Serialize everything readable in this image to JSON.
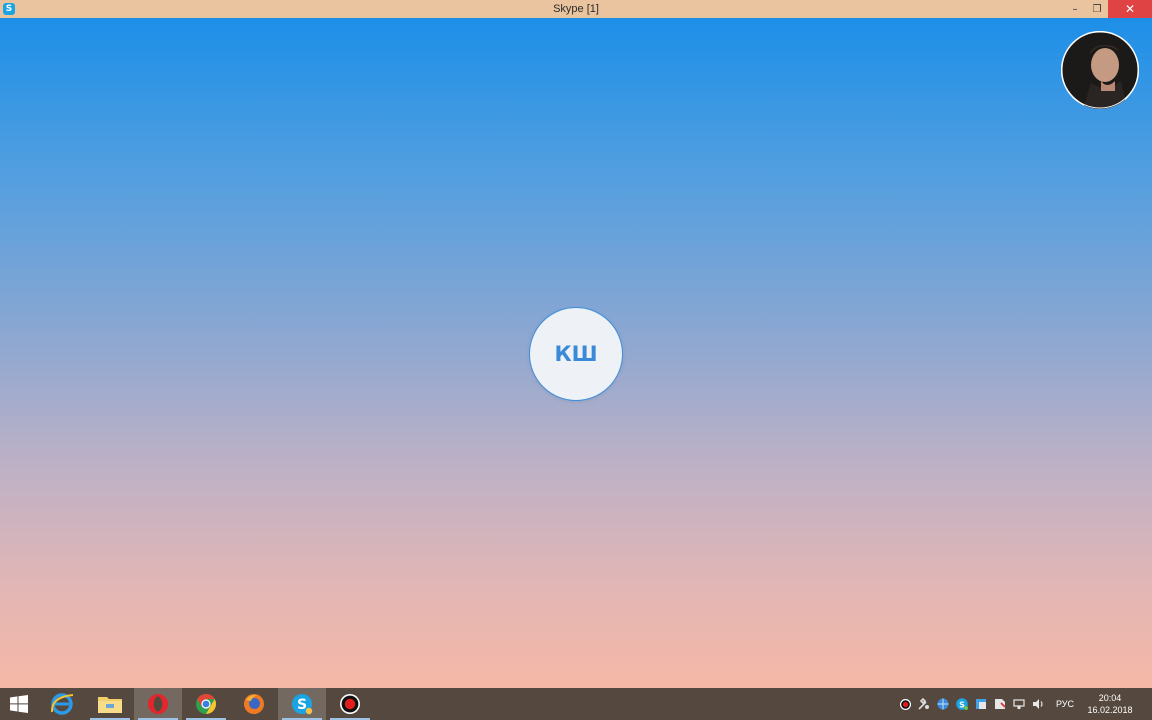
{
  "window": {
    "title": "Skype [1]",
    "app_icon_letter": "S",
    "minimize": "–",
    "restore": "❐",
    "close": "✕"
  },
  "call": {
    "remote_initials": "КШ"
  },
  "taskbar": {
    "apps": [
      {
        "icon": "windows-start-icon"
      },
      {
        "icon": "internet-explorer-icon"
      },
      {
        "icon": "file-explorer-icon"
      },
      {
        "icon": "opera-icon"
      },
      {
        "icon": "chrome-icon"
      },
      {
        "icon": "firefox-icon"
      },
      {
        "icon": "skype-icon"
      },
      {
        "icon": "record-icon"
      }
    ],
    "tray": {
      "language": "РУС",
      "time": "20:04",
      "date": "16.02.2018"
    }
  },
  "colors": {
    "gradient_top": "#1d8fe8",
    "gradient_bottom": "#f6b8a6",
    "titlebar": "#e9c49e",
    "close_button": "#e04343",
    "taskbar": "#55483f",
    "initials": "#3a8ad8"
  }
}
